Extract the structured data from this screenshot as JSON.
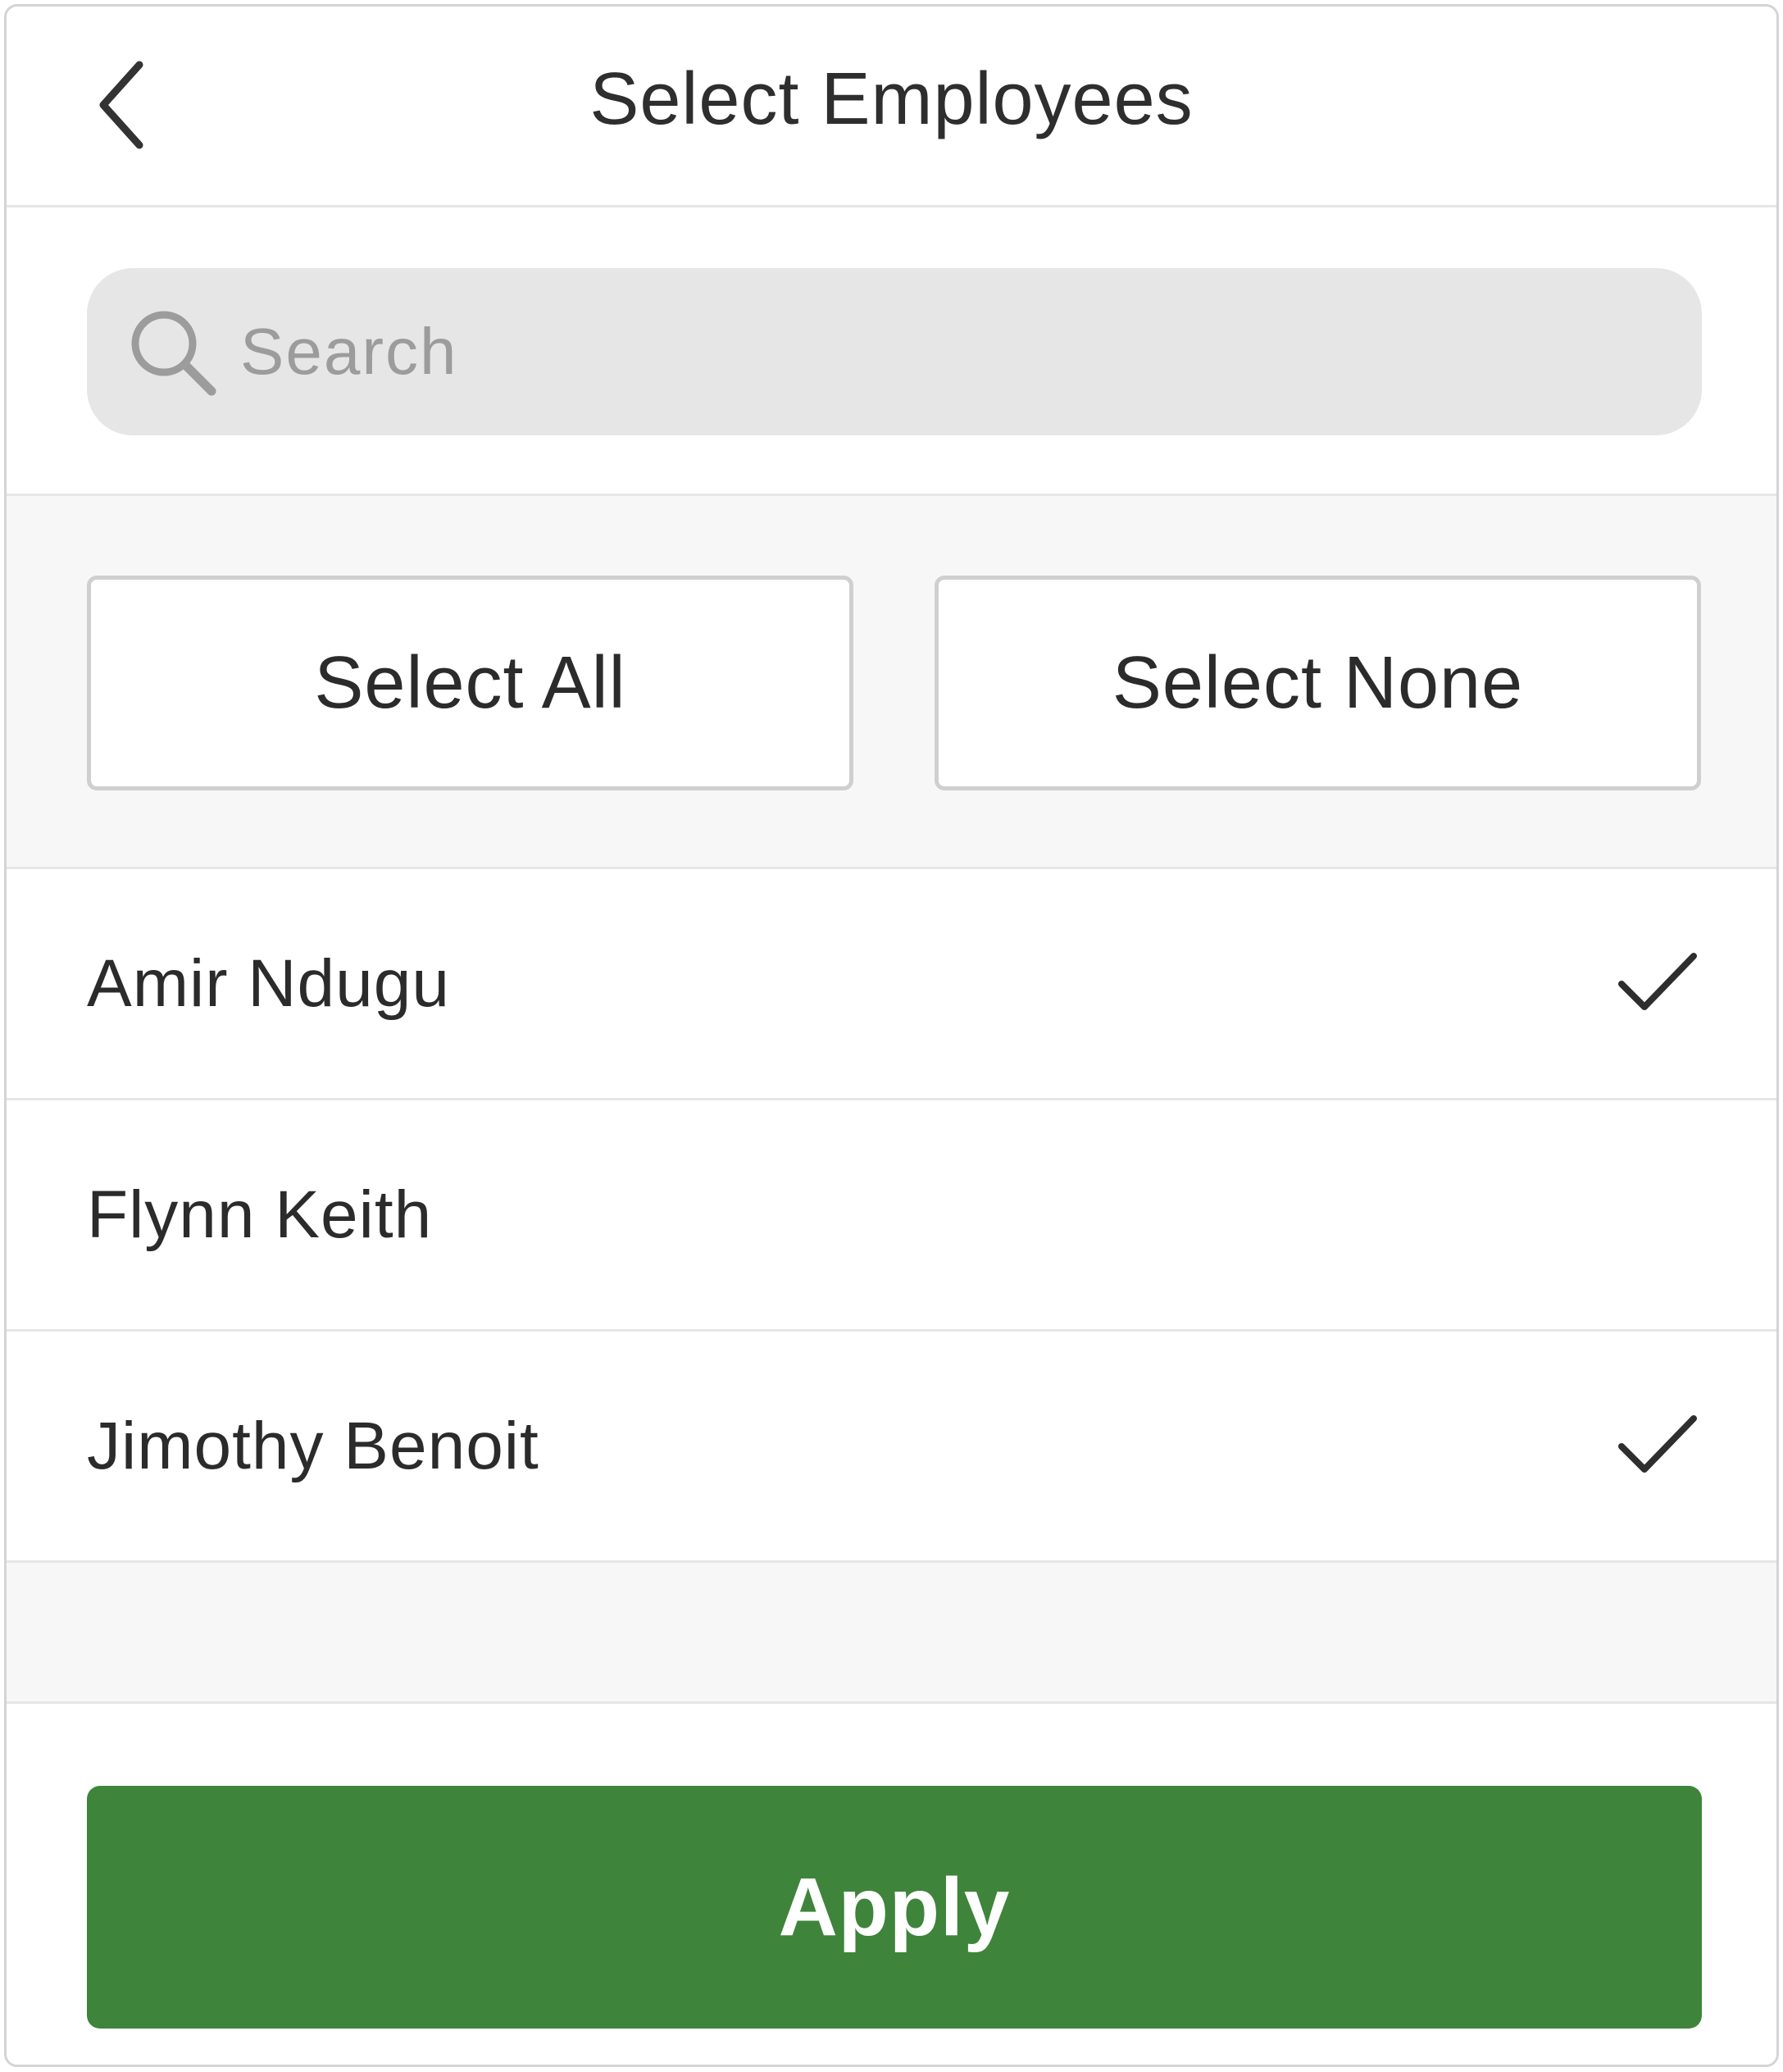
{
  "header": {
    "title": "Select Employees",
    "back_icon": "chevron-left-icon"
  },
  "search": {
    "placeholder": "Search",
    "value": "",
    "icon": "search-icon"
  },
  "actions": {
    "select_all_label": "Select All",
    "select_none_label": "Select None"
  },
  "employees": [
    {
      "name": "Amir Ndugu",
      "selected": true
    },
    {
      "name": "Flynn Keith",
      "selected": false
    },
    {
      "name": "Jimothy Benoit",
      "selected": true
    }
  ],
  "footer": {
    "apply_label": "Apply"
  },
  "colors": {
    "accent": "#3e843b",
    "text": "#2b2b2b",
    "search_bg": "#e6e6e6",
    "section_bg": "#f7f7f7"
  }
}
